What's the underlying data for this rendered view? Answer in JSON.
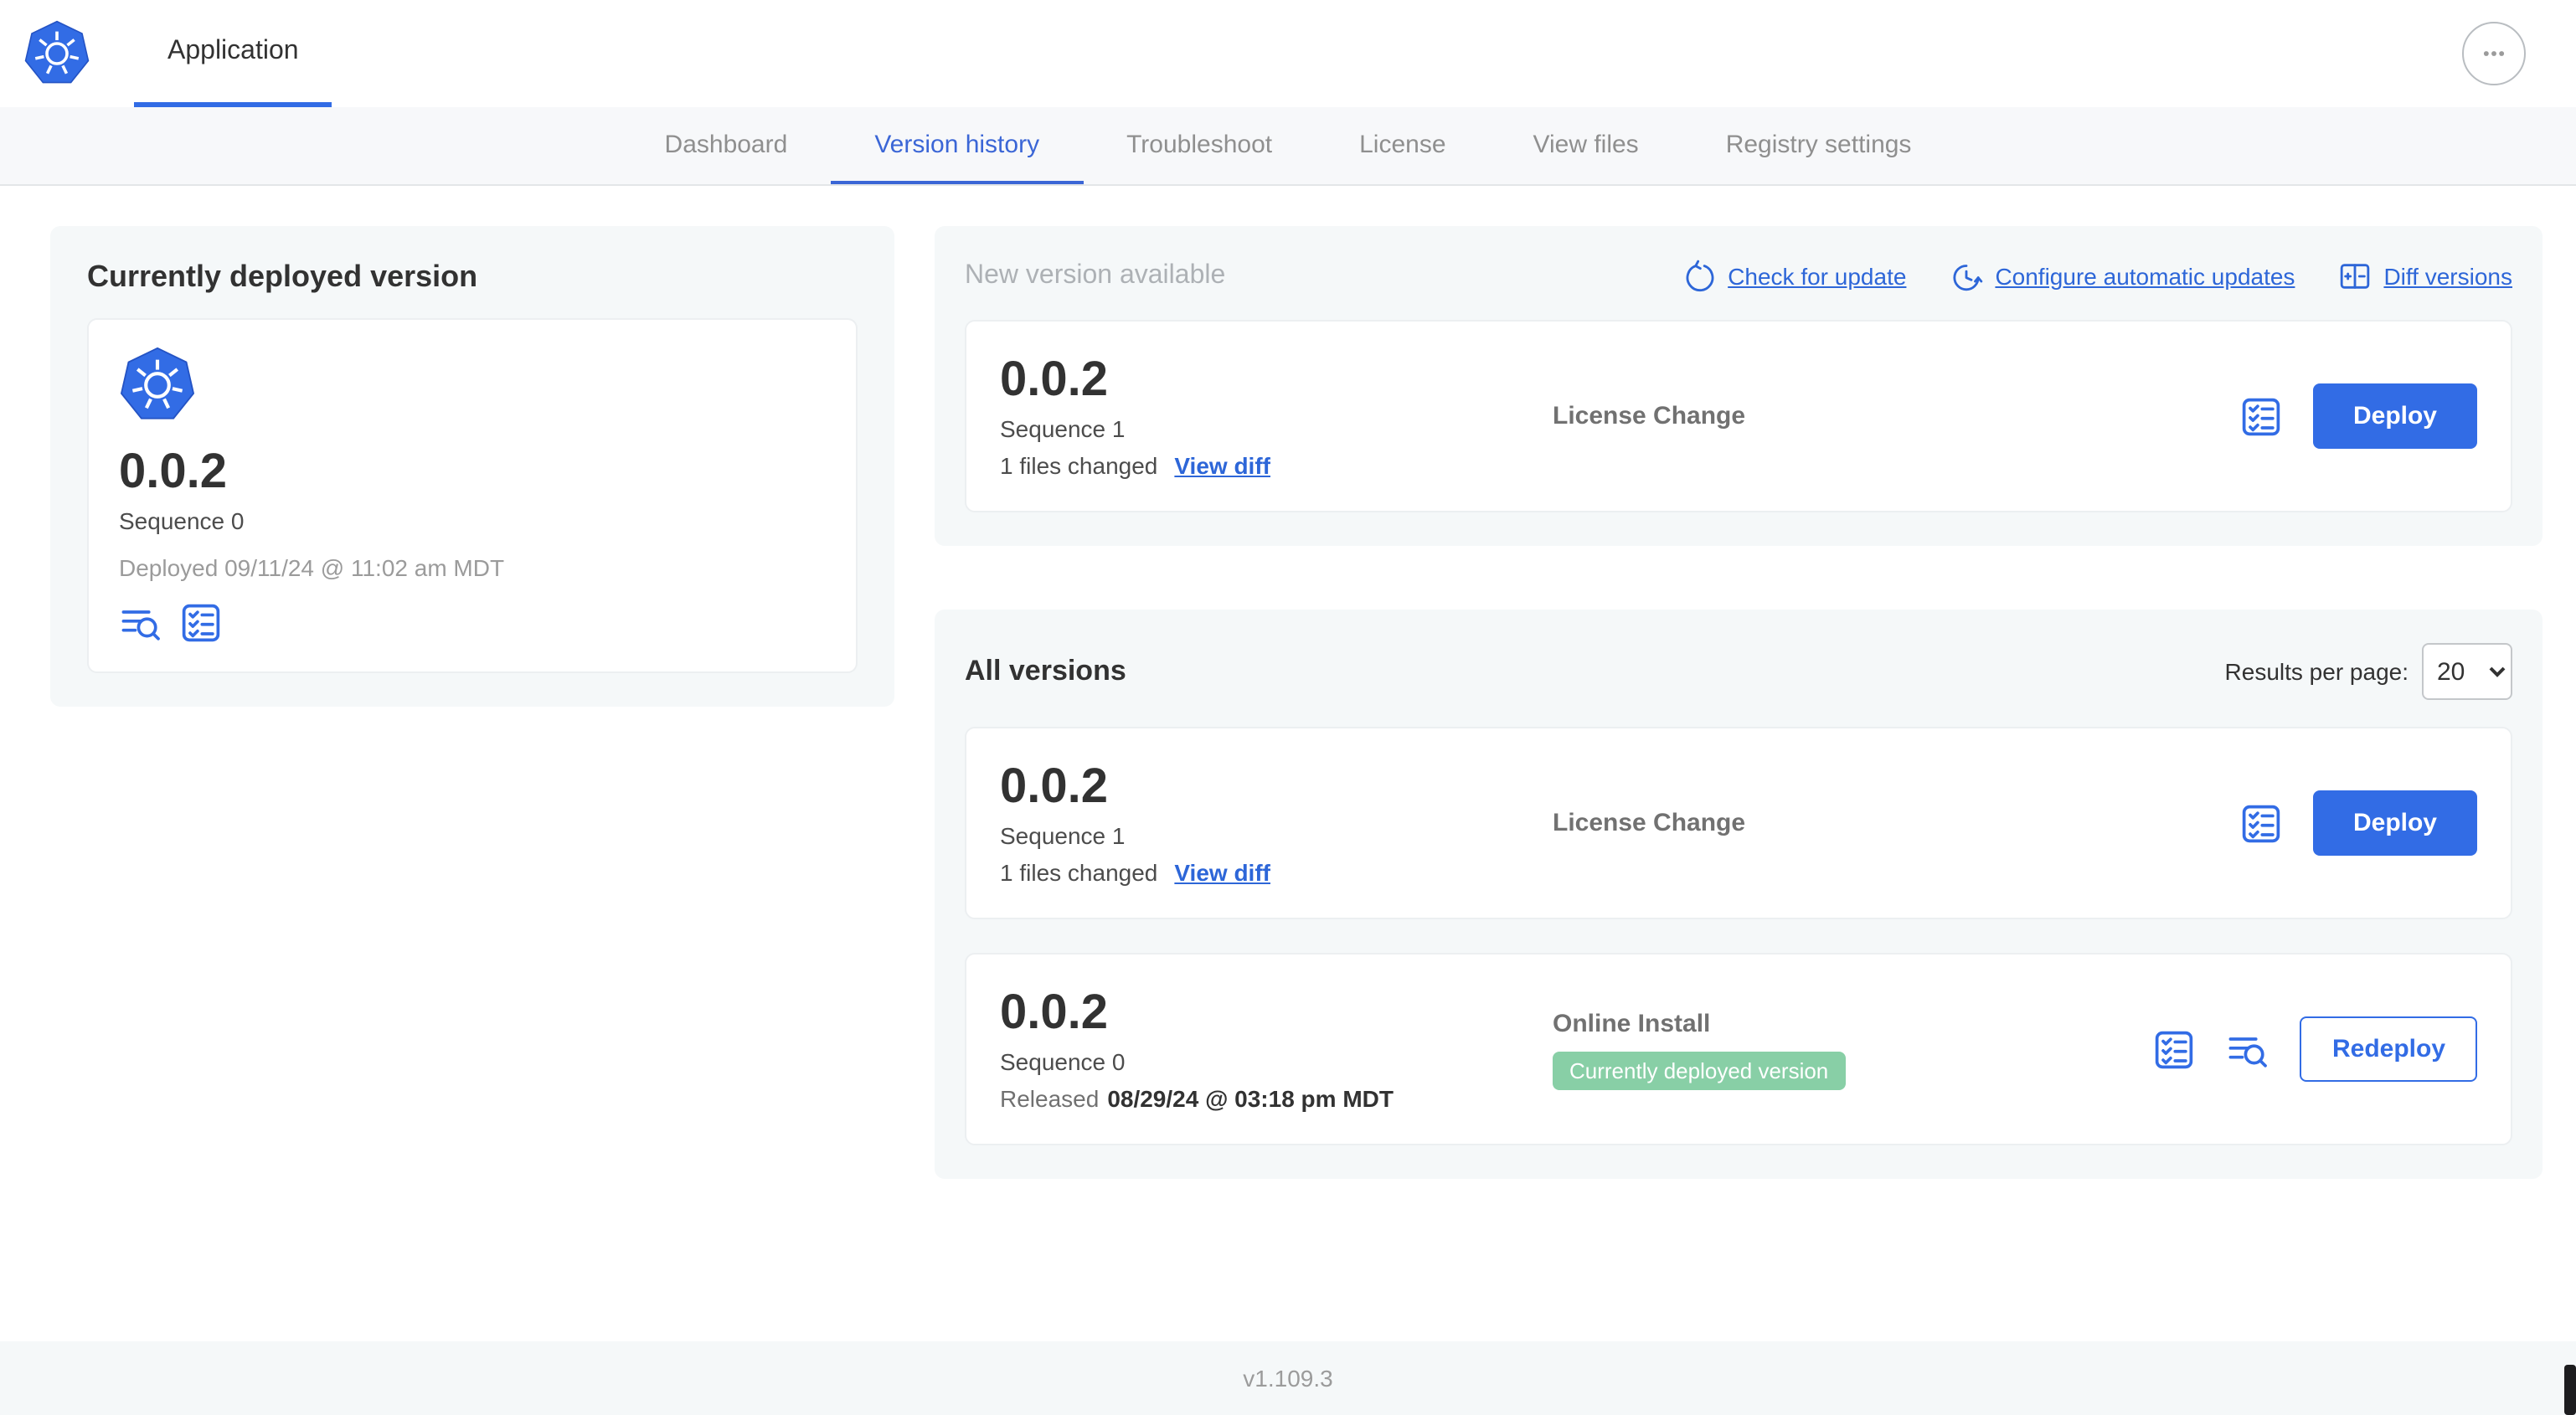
{
  "colors": {
    "accent_blue": "#326ce5",
    "link_blue": "#2d66d8",
    "badge_green": "#88cfa6",
    "card_bg": "#f5f8f9",
    "text_dark": "#323232",
    "text_gray": "#9b9b9b"
  },
  "icons": {
    "brand": "kubernetes-logo",
    "more": "ellipsis-icon",
    "check_for_update": "refresh-circle-icon",
    "configure_auto_updates": "clock-refresh-icon",
    "diff_versions": "diff-columns-icon",
    "release_notes": "checklist-icon",
    "logs": "lines-magnifier-icon"
  },
  "header": {
    "app_tab": "Application"
  },
  "nav": {
    "active_tab": "Version history",
    "tabs": [
      {
        "label": "Dashboard"
      },
      {
        "label": "Version history"
      },
      {
        "label": "Troubleshoot"
      },
      {
        "label": "License"
      },
      {
        "label": "View files"
      },
      {
        "label": "Registry settings"
      }
    ]
  },
  "current_version": {
    "title": "Currently deployed version",
    "version": "0.0.2",
    "sequence": "Sequence 0",
    "deployed": "Deployed 09/11/24 @ 11:02 am MDT"
  },
  "new_version": {
    "title": "New version available",
    "check_for_update": "Check for update",
    "configure_auto_updates": "Configure automatic updates",
    "diff_versions": "Diff versions",
    "row": {
      "version": "0.0.2",
      "sequence": "Sequence 1",
      "files_changed": "1 files changed",
      "view_diff": "View diff",
      "change_type": "License Change",
      "action": "Deploy"
    }
  },
  "all_versions": {
    "title": "All versions",
    "results_per_page_label": "Results per page:",
    "results_per_page_value": "20",
    "rows": [
      {
        "version": "0.0.2",
        "sequence": "Sequence 1",
        "files_changed": "1 files changed",
        "view_diff": "View diff",
        "change_type": "License Change",
        "action": "Deploy"
      },
      {
        "version": "0.0.2",
        "sequence": "Sequence 0",
        "released_label": "Released",
        "released_date": "08/29/24 @ 03:18 pm MDT",
        "change_type": "Online Install",
        "badge": "Currently deployed version",
        "action": "Redeploy"
      }
    ]
  },
  "footer": {
    "app_version": "v1.109.3"
  }
}
